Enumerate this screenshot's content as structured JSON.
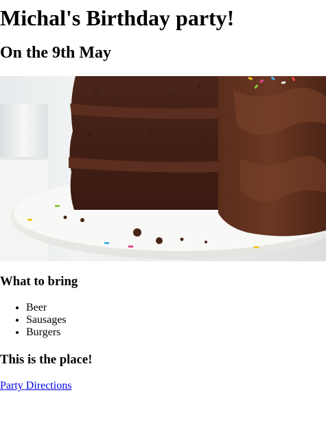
{
  "page": {
    "title": "Michal's Birthday party!",
    "subtitle": "On the 9th May"
  },
  "hero_image": {
    "subject": "chocolate layer cake with sprinkles on a white cake stand"
  },
  "bring_section": {
    "heading": "What to bring",
    "items": [
      "Beer",
      "Sausages",
      "Burgers"
    ]
  },
  "place_section": {
    "heading": "This is the place!",
    "link_label": "Party Directions"
  },
  "colors": {
    "link": "#0000ee",
    "text": "#000000",
    "background": "#ffffff"
  }
}
